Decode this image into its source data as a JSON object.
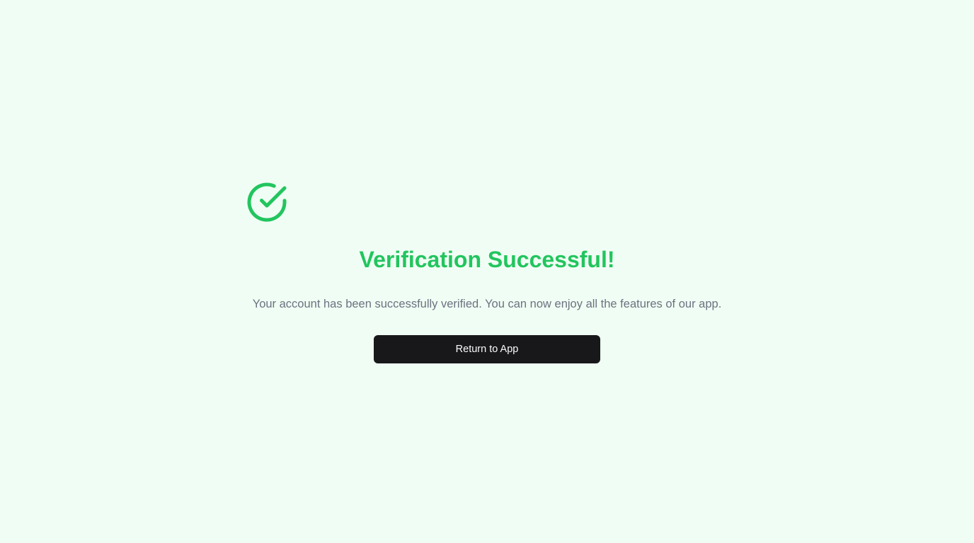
{
  "status": {
    "icon": "check-circle-icon",
    "title": "Verification Successful!",
    "message": "Your account has been successfully verified. You can now enjoy all the features of our app."
  },
  "actions": {
    "return_label": "Return to App"
  },
  "colors": {
    "background": "#f0fdf4",
    "accent": "#22c55e",
    "text_muted": "#6b7280",
    "button_bg": "#18181b",
    "button_text": "#fafafa"
  }
}
